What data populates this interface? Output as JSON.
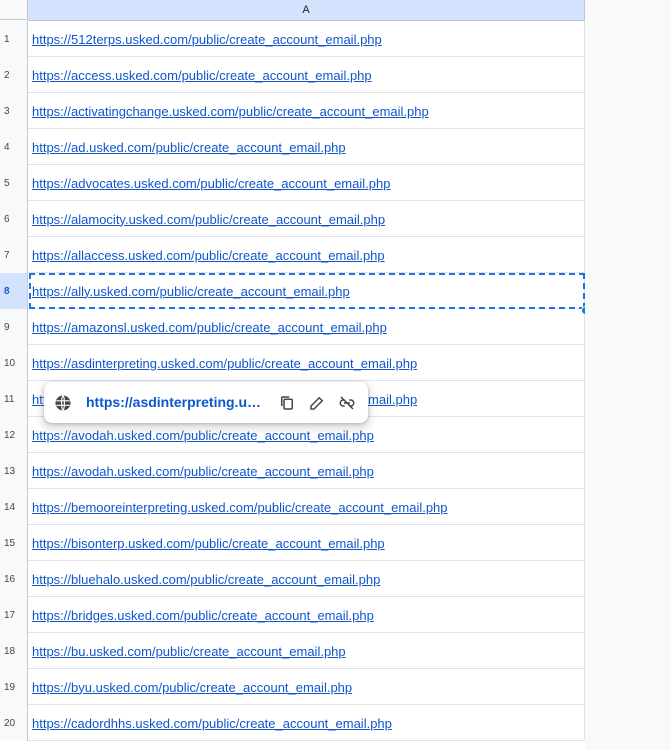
{
  "column_header": "A",
  "rows": [
    {
      "num": "1",
      "url": "https://512terps.usked.com/public/create_account_email.php"
    },
    {
      "num": "2",
      "url": "https://access.usked.com/public/create_account_email.php"
    },
    {
      "num": "3",
      "url": "https://activatingchange.usked.com/public/create_account_email.php"
    },
    {
      "num": "4",
      "url": "https://ad.usked.com/public/create_account_email.php"
    },
    {
      "num": "5",
      "url": "https://advocates.usked.com/public/create_account_email.php"
    },
    {
      "num": "6",
      "url": "https://alamocity.usked.com/public/create_account_email.php"
    },
    {
      "num": "7",
      "url": "https://allaccess.usked.com/public/create_account_email.php"
    },
    {
      "num": "8",
      "url": "https://ally.usked.com/public/create_account_email.php"
    },
    {
      "num": "9",
      "url": "https://amazonsl.usked.com/public/create_account_email.php"
    },
    {
      "num": "10",
      "url": "https://asdinterpreting.usked.com/public/create_account_email.php"
    },
    {
      "num": "11",
      "url": "https://asdinterpreting.usked.com/public/create_account_email.php"
    },
    {
      "num": "12",
      "url": "https://avodah.usked.com/public/create_account_email.php"
    },
    {
      "num": "13",
      "url": "https://avodah.usked.com/public/create_account_email.php"
    },
    {
      "num": "14",
      "url": "https://bemooreinterpreting.usked.com/public/create_account_email.php"
    },
    {
      "num": "15",
      "url": "https://bisonterp.usked.com/public/create_account_email.php"
    },
    {
      "num": "16",
      "url": "https://bluehalo.usked.com/public/create_account_email.php"
    },
    {
      "num": "17",
      "url": "https://bridges.usked.com/public/create_account_email.php"
    },
    {
      "num": "18",
      "url": "https://bu.usked.com/public/create_account_email.php"
    },
    {
      "num": "19",
      "url": "https://byu.usked.com/public/create_account_email.php"
    },
    {
      "num": "20",
      "url": "https://cadordhhs.usked.com/public/create_account_email.php"
    }
  ],
  "active_row": "8",
  "link_chip": {
    "url": "https://asdinterpreting.us...",
    "icons": [
      "globe-icon",
      "copy-icon",
      "edit-icon",
      "unlink-icon"
    ]
  },
  "colors": {
    "link": "#1155cc",
    "selection": "#1a73e8",
    "header_active": "#d3e3fd"
  }
}
